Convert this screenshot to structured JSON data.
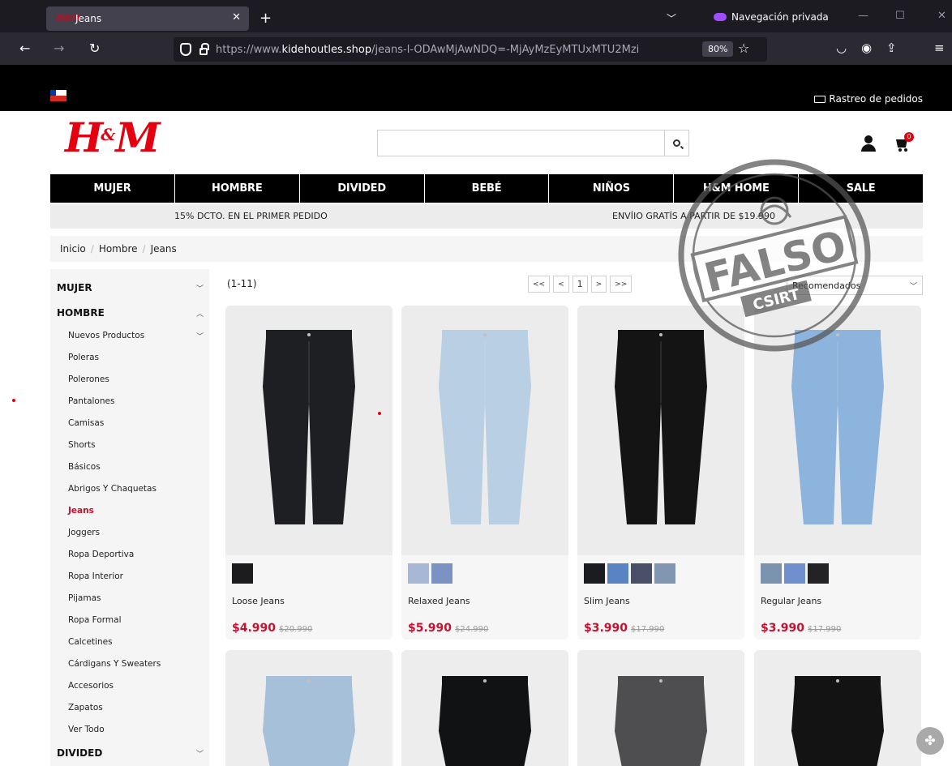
{
  "browser": {
    "tab_title": "Jeans",
    "tab_favicon": "H&M",
    "new_tab": "+",
    "tabs_menu": "⌄",
    "private_label": "Navegación privada",
    "url_prefix": "https://www.",
    "url_host": "kidehoutles.shop",
    "url_path": "/jeans-l-ODAwMjAwNDQ=-MjAyMzEyMTUxMTU2Mzi",
    "zoom": "80%"
  },
  "topbar": {
    "tracking": "Rastreo de pedidos"
  },
  "header": {
    "logo": "H",
    "logo_amp": "&",
    "logo_m": "M",
    "search_value": "",
    "cart_count": "0"
  },
  "nav": [
    "MUJER",
    "HOMBRE",
    "DIVIDED",
    "BEBÉ",
    "NIÑOS",
    "H&M HOME",
    "SALE"
  ],
  "promo": {
    "left": "15% DCTO. EN EL PRIMER PEDIDO",
    "right": "ENVÍIO GRATÍS A PARTIR DE $19.990"
  },
  "breadcrumb": [
    "Inicio",
    "Hombre",
    "Jeans"
  ],
  "sidebar": {
    "mujer": "MUJER",
    "hombre": "HOMBRE",
    "divided": "DIVIDED",
    "items": [
      "Nuevos Productos",
      "Poleras",
      "Polerones",
      "Pantalones",
      "Camisas",
      "Shorts",
      "Básicos",
      "Abrigos Y Chaquetas",
      "Jeans",
      "Joggers",
      "Ropa Deportiva",
      "Ropa Interior",
      "Pijamas",
      "Ropa Formal",
      "Calcetines",
      "Cárdigans Y Sweaters",
      "Accesorios",
      "Zapatos",
      "Ver Todo"
    ]
  },
  "listing": {
    "count": "(1-11)",
    "pager": [
      "<<",
      "<",
      "1",
      ">",
      ">>"
    ],
    "sort": "Recomendados"
  },
  "products": [
    {
      "name": "Loose Jeans",
      "price": "$4.990",
      "old": "$20.990",
      "color": "#1e1f22",
      "swatches": [
        "#1c1c1e"
      ]
    },
    {
      "name": "Relaxed Jeans",
      "price": "$5.990",
      "old": "$24.990",
      "color": "#b9cfe4",
      "swatches": [
        "#a6b8d6",
        "#7a93c2"
      ]
    },
    {
      "name": "Slim Jeans",
      "price": "$3.990",
      "old": "$17.990",
      "color": "#141414",
      "swatches": [
        "#1b1c20",
        "#5a83c4",
        "#4a5068",
        "#8196b0"
      ]
    },
    {
      "name": "Regular Jeans",
      "price": "$3.990",
      "old": "$17.990",
      "color": "#8db4dc",
      "swatches": [
        "#7b93ae",
        "#6f8fcf",
        "#232325"
      ]
    }
  ],
  "products_row2": [
    "#a6c0da",
    "#111214",
    "#4e4e50",
    "#131313"
  ],
  "stamp": {
    "word": "FALSO",
    "org": "CSIRT"
  }
}
